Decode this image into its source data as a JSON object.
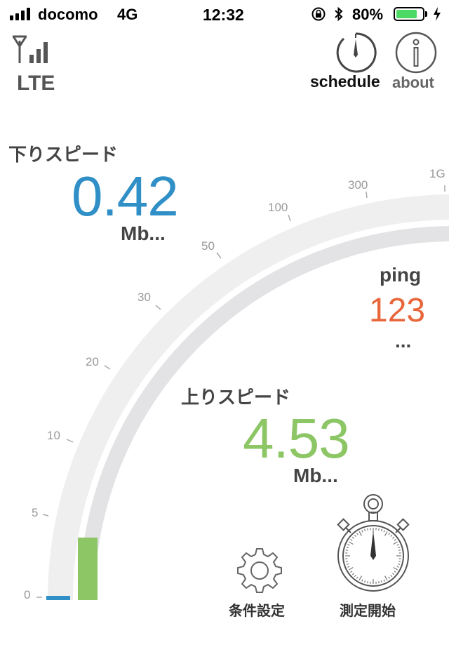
{
  "status_bar": {
    "carrier": "docomo",
    "network": "4G",
    "time": "12:32",
    "battery_percent": "80%",
    "battery_level": 0.8,
    "icons": [
      "signal-bars-icon",
      "rotation-lock-icon",
      "bluetooth-icon",
      "battery-icon",
      "charging-bolt-icon"
    ]
  },
  "header": {
    "network_type": "LTE",
    "schedule_label": "schedule",
    "about_label": "about",
    "about_icon_glyph": "i"
  },
  "download": {
    "label": "下りスピード",
    "value": "0.42",
    "unit": "Mb...",
    "color": "#2f8fc6"
  },
  "ping": {
    "label": "ping",
    "value": "123",
    "unit": "...",
    "color": "#e8663a"
  },
  "upload": {
    "label": "上りスピード",
    "value": "4.53",
    "unit": "Mb...",
    "color": "#8cc665"
  },
  "gauge": {
    "ticks": [
      "0",
      "5",
      "10",
      "20",
      "30",
      "50",
      "100",
      "300",
      "1G"
    ],
    "download_fill_color": "#2f8fc6",
    "upload_fill_color": "#8cc665"
  },
  "controls": {
    "settings_label": "条件設定",
    "start_label": "測定開始"
  }
}
